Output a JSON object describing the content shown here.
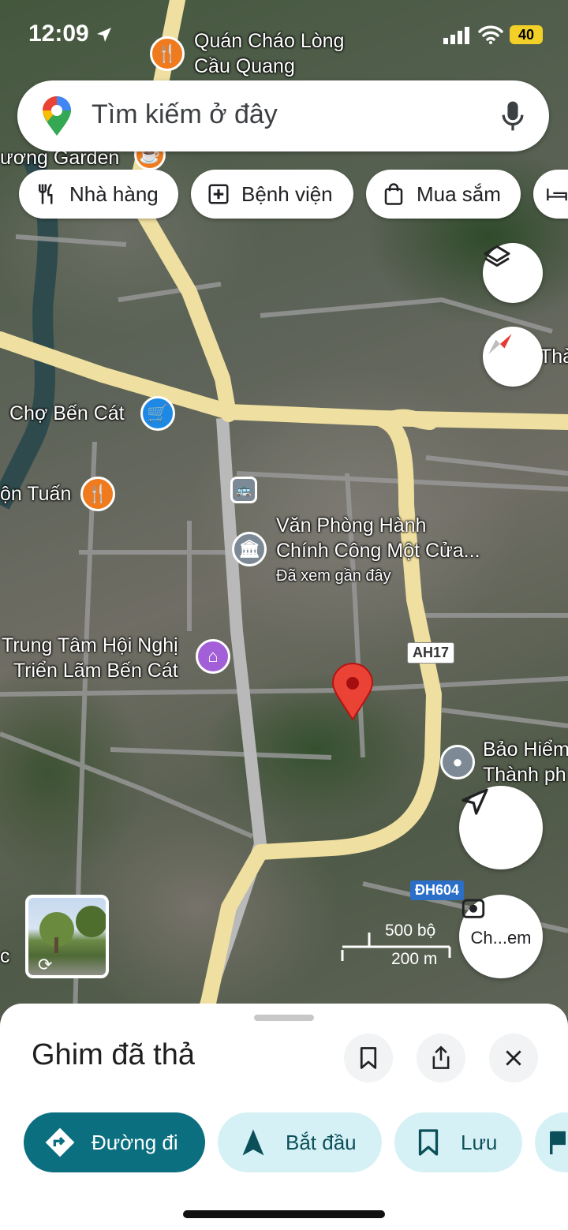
{
  "status_bar": {
    "time": "12:09",
    "battery": "40"
  },
  "search": {
    "placeholder": "Tìm kiếm ở đây"
  },
  "chips": [
    {
      "label": "Nhà hàng",
      "icon": "restaurant-icon"
    },
    {
      "label": "Bệnh viện",
      "icon": "hospital-icon"
    },
    {
      "label": "Mua sắm",
      "icon": "shopping-bag-icon"
    }
  ],
  "map": {
    "pois": [
      {
        "name": "Quán Cháo Lòng Cầu Quang",
        "line1": "Quán Cháo Lòng",
        "line2": "Cầu Quang",
        "icon": "restaurant-icon"
      },
      {
        "name": "ương Garden",
        "icon": "cafe-icon"
      },
      {
        "name": "Chợ Bến Cát",
        "icon": "cart-icon"
      },
      {
        "name": "ộn Tuấn",
        "icon": "restaurant-icon"
      },
      {
        "name": "Văn Phòng Hành Chính Công Một Cửa...",
        "line1": "Văn Phòng Hành",
        "line2": "Chính Công Một Cửa...",
        "sub": "Đã xem gần đây",
        "icon": "government-icon"
      },
      {
        "name": "Trung Tâm Hội Nghị Triển Lãm Bến Cát",
        "line1": "Trung Tâm Hội Nghị",
        "line2": "Triển Lãm Bến Cát",
        "icon": "castle-icon"
      },
      {
        "name": "Bảo Hiểm Thành phố",
        "line1": "Bảo Hiểm",
        "line2": "Thành ph",
        "icon": "place-icon"
      }
    ],
    "edge_label": "Thà",
    "left_edge_label": "c",
    "road_shields": {
      "ah17": "AH17",
      "dh604": "ĐH604"
    },
    "scale": {
      "imperial": "500 bộ",
      "metric": "200 m"
    },
    "street_view_label": "Street View",
    "lens_label": "Ch...em"
  },
  "sheet": {
    "title": "Ghim đã thả",
    "actions": [
      {
        "label": "Đường đi",
        "icon": "directions-icon"
      },
      {
        "label": "Bắt đầu",
        "icon": "navigation-arrow-icon"
      },
      {
        "label": "Lưu",
        "icon": "bookmark-icon"
      }
    ]
  },
  "colors": {
    "accent": "#0b6f7f",
    "pin": "#ea4335",
    "road": "#efdfa0"
  }
}
